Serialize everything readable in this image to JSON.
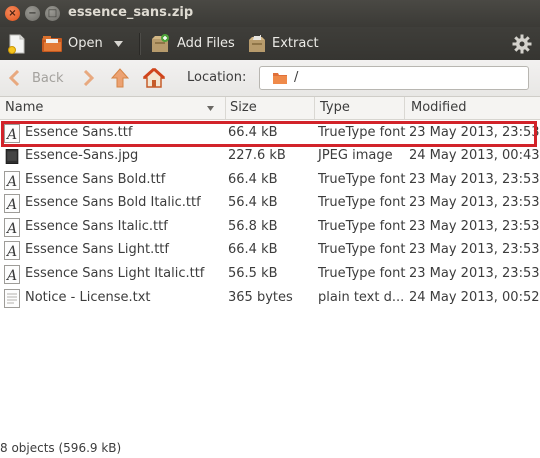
{
  "window": {
    "title": "essence_sans.zip",
    "close_glyph": "×",
    "minimize_glyph": "−",
    "maximize_glyph": "□"
  },
  "toolbar": {
    "open_label": "Open",
    "add_files_label": "Add Files",
    "extract_label": "Extract"
  },
  "navigation": {
    "back_label": "Back",
    "location_label": "Location:",
    "location_value": "/"
  },
  "columns": {
    "name": "Name",
    "size": "Size",
    "type": "Type",
    "modified": "Modified"
  },
  "files": [
    {
      "name": "Essence Sans.ttf",
      "size": "66.4 kB",
      "type": "TrueType font",
      "modified": "23 May 2013, 23:53",
      "icon": "font-file-icon"
    },
    {
      "name": "Essence-Sans.jpg",
      "size": "227.6 kB",
      "type": "JPEG image",
      "modified": "24 May 2013, 00:43",
      "icon": "image-file-icon"
    },
    {
      "name": "Essence Sans Bold.ttf",
      "size": "66.4 kB",
      "type": "TrueType font",
      "modified": "23 May 2013, 23:53",
      "icon": "font-file-icon"
    },
    {
      "name": "Essence Sans Bold Italic.ttf",
      "size": "56.4 kB",
      "type": "TrueType font",
      "modified": "23 May 2013, 23:53",
      "icon": "font-file-icon"
    },
    {
      "name": "Essence Sans Italic.ttf",
      "size": "56.8 kB",
      "type": "TrueType font",
      "modified": "23 May 2013, 23:53",
      "icon": "font-file-icon"
    },
    {
      "name": "Essence Sans Light.ttf",
      "size": "66.4 kB",
      "type": "TrueType font",
      "modified": "23 May 2013, 23:53",
      "icon": "font-file-icon"
    },
    {
      "name": "Essence Sans Light Italic.ttf",
      "size": "56.5 kB",
      "type": "TrueType font",
      "modified": "23 May 2013, 23:53",
      "icon": "font-file-icon"
    },
    {
      "name": "Notice - License.txt",
      "size": "365 bytes",
      "type": "plain text d...",
      "modified": "24 May 2013, 00:52",
      "icon": "text-file-icon"
    }
  ],
  "status": {
    "text": "8 objects (596.9 kB)"
  },
  "colors": {
    "highlight_border": "#d2232a",
    "titlebar": "#3b3a36",
    "close_button": "#e0531b"
  }
}
